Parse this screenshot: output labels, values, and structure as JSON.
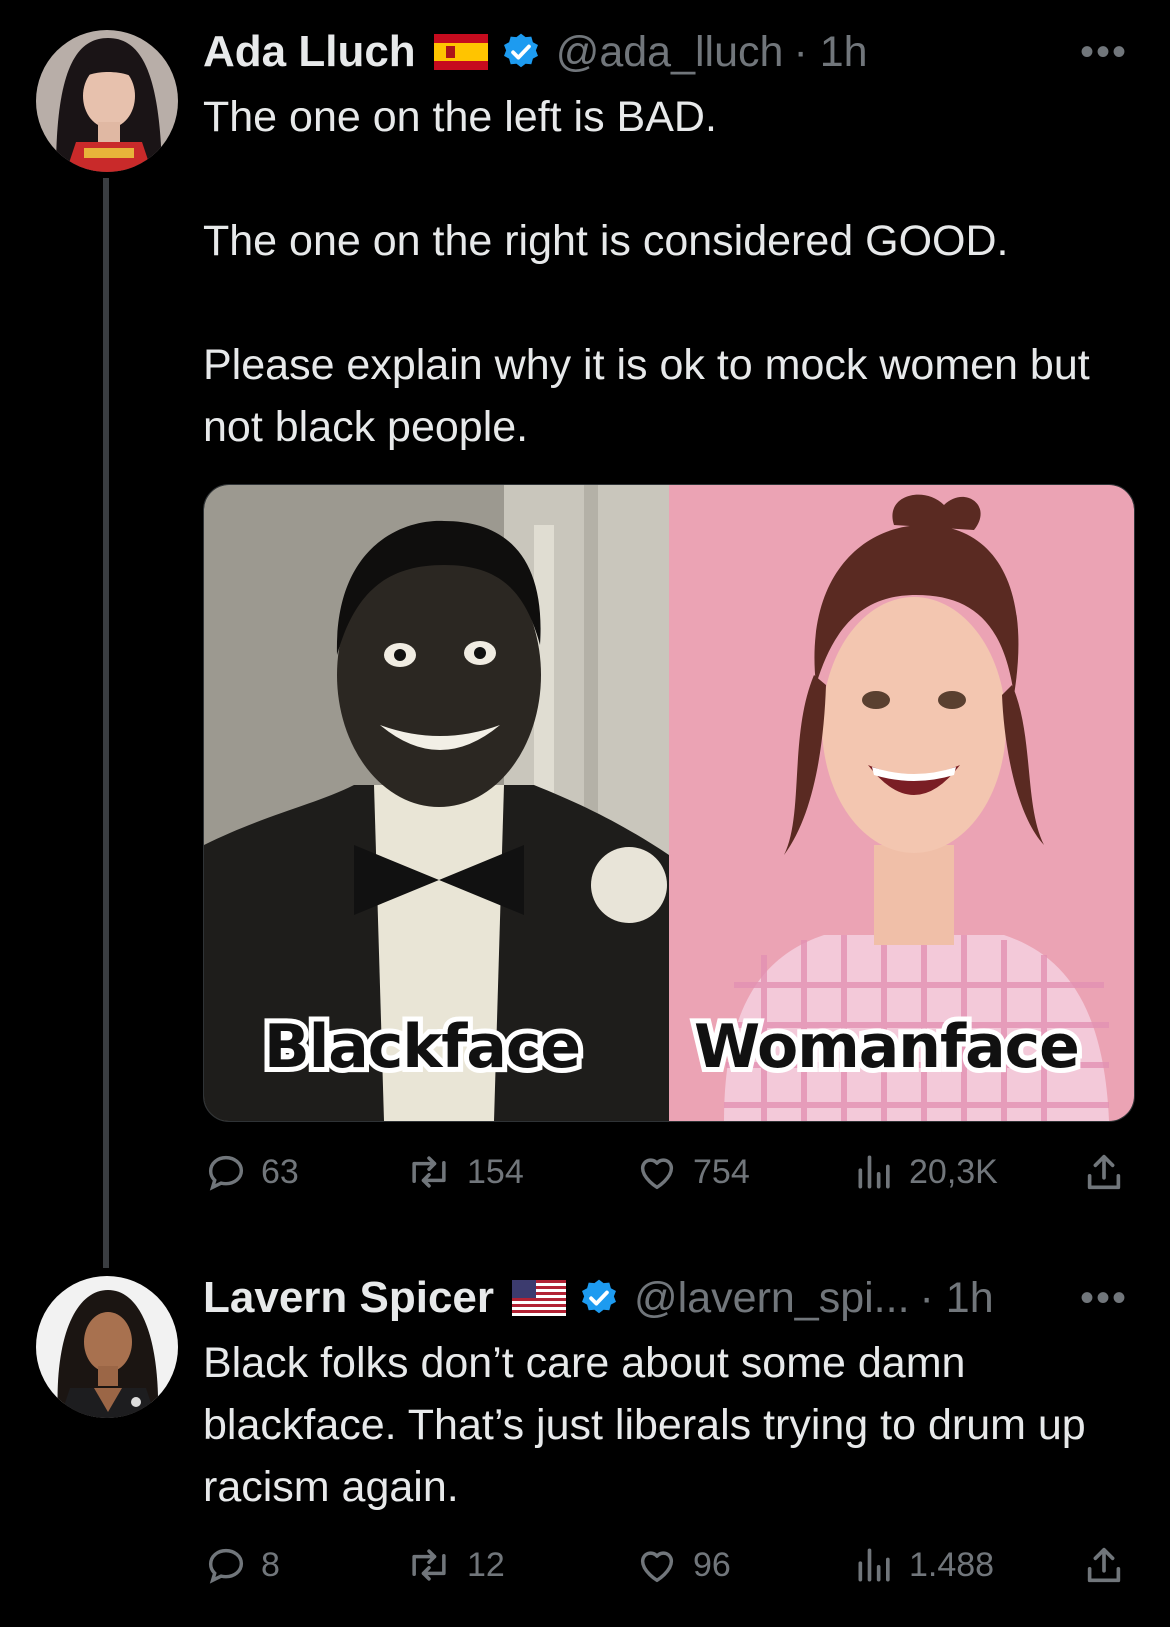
{
  "tweets": [
    {
      "author": "Ada Lluch",
      "flag": "spain-flag",
      "verified": true,
      "handle": "@ada_lluch",
      "time": "· 1h",
      "more": "•••",
      "text": "The one on the left is BAD.\n\nThe one on the right is considered GOOD.\n\nPlease explain why it is ok to mock women but not black people.",
      "media": {
        "left_caption": "Blackface",
        "right_caption": "Womanface"
      },
      "stats": {
        "replies": "63",
        "retweets": "154",
        "likes": "754",
        "views": "20,3K"
      }
    },
    {
      "author": "Lavern Spicer",
      "flag": "usa-flag",
      "verified": true,
      "handle": "@lavern_spi...",
      "time": "· 1h",
      "more": "•••",
      "text": "Black folks don’t care about some damn blackface. That’s just liberals trying to drum up racism again.",
      "stats": {
        "replies": "8",
        "retweets": "12",
        "likes": "96",
        "views": "1.488"
      }
    }
  ],
  "icons": [
    "reply-icon",
    "retweet-icon",
    "like-icon",
    "views-icon",
    "share-icon",
    "verified-badge-icon"
  ],
  "colors": {
    "background": "#000000",
    "text": "#e7e9ea",
    "muted": "#71767b",
    "verified": "#1d9bf0",
    "thread_line": "#3a3d41"
  }
}
